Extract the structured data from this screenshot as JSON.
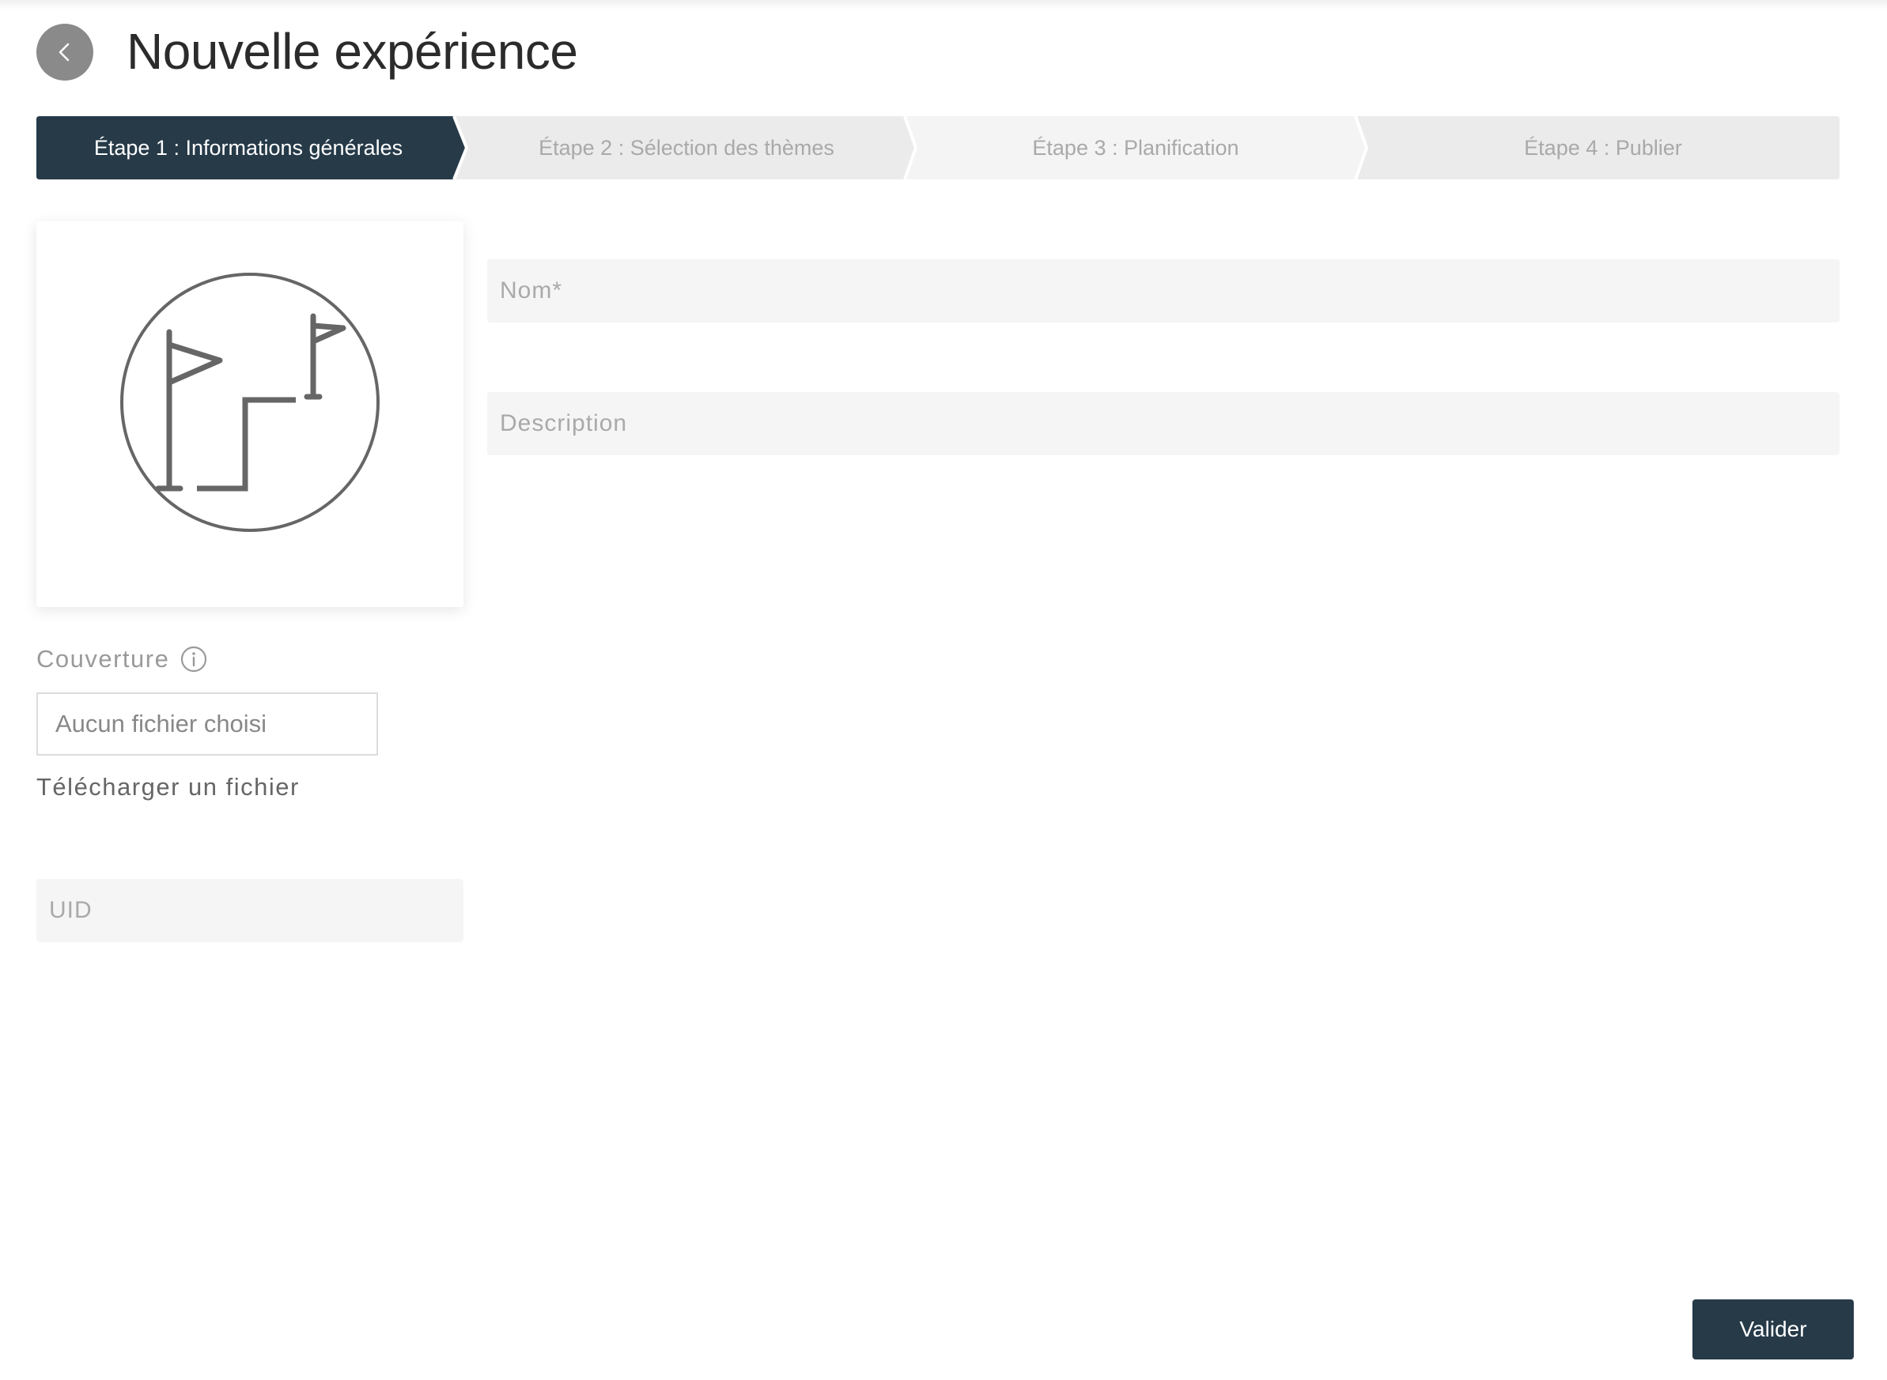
{
  "header": {
    "title": "Nouvelle expérience",
    "back_icon": "chevron-left-icon"
  },
  "stepper": {
    "active_index": 0,
    "steps": [
      {
        "label": "Étape 1 : Informations générales"
      },
      {
        "label": "Étape 2 : Sélection des thèmes"
      },
      {
        "label": "Étape 3 : Planification"
      },
      {
        "label": "Étape 4 : Publier"
      }
    ]
  },
  "form": {
    "name_placeholder": "Nom*",
    "name_value": "",
    "description_placeholder": "Description",
    "description_value": "",
    "uid_placeholder": "UID",
    "uid_value": ""
  },
  "cover": {
    "label": "Couverture",
    "info_icon": "info-icon",
    "file_status": "Aucun fichier choisi",
    "upload_label": "Télécharger un fichier",
    "placeholder_icon": "flags-path-icon"
  },
  "actions": {
    "submit_label": "Valider"
  },
  "colors": {
    "primary_dark": "#263a48",
    "step_inactive": "#ebebeb",
    "step_inactive_alt": "#f4f4f4",
    "back_button": "#8a8a8a",
    "field_bg": "#f5f5f5"
  }
}
